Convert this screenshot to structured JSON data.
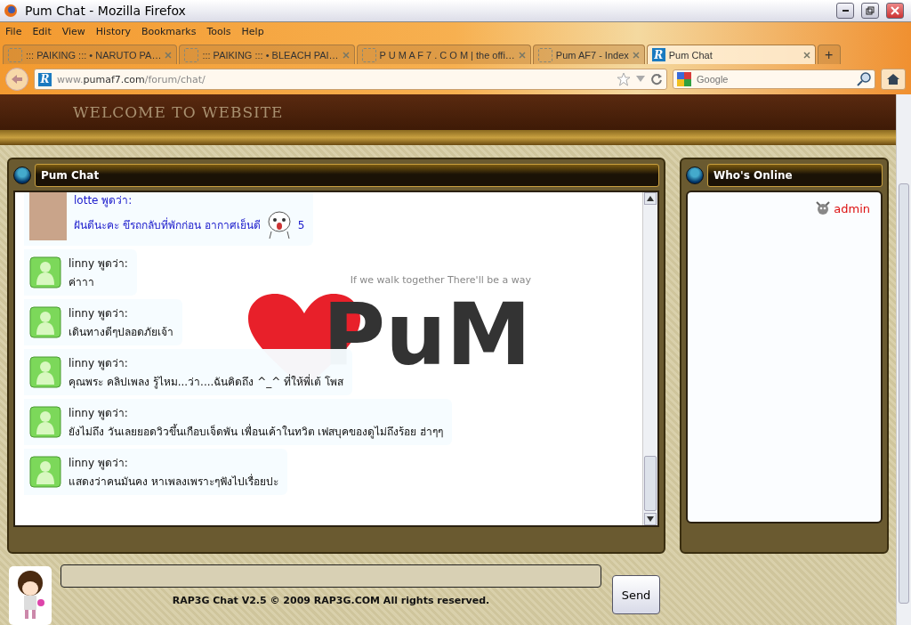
{
  "window": {
    "title": "Pum Chat - Mozilla Firefox"
  },
  "menu": [
    "File",
    "Edit",
    "View",
    "History",
    "Bookmarks",
    "Tools",
    "Help"
  ],
  "tabs": [
    {
      "label": "::: PAIKING ::: • NARUTO PA…",
      "selected": false
    },
    {
      "label": "::: PAIKING ::: • BLEACH PAI…",
      "selected": false
    },
    {
      "label": "P U M A F 7 . C O M | the offi…",
      "selected": false
    },
    {
      "label": "Pum AF7 - Index",
      "selected": false
    },
    {
      "label": "Pum Chat",
      "selected": true
    }
  ],
  "new_tab": "+",
  "tab_logo": "R",
  "address_logo": "R",
  "address": {
    "prefix": "www.",
    "domain": "pumaf7.com",
    "path": "/forum/chat/"
  },
  "search": {
    "placeholder": "Google"
  },
  "header": {
    "title": "WELCOME TO WEBSITE"
  },
  "chat": {
    "title": "Pum Chat",
    "banner": {
      "tagline": "If we walk together There'll be a way",
      "word": "PuM"
    },
    "messages": [
      {
        "kind": "photo",
        "author": "lotte พูดว่า:",
        "text": "ฝันดีนะคะ ขึรถกลับที่พักก่อน อากาศเย็นดี",
        "extra": "5",
        "color": "#1a1acc"
      },
      {
        "kind": "default",
        "author": "linny พูดว่า:",
        "text": "ค่าาา",
        "color": "#111111"
      },
      {
        "kind": "default",
        "author": "linny พูดว่า:",
        "text": "เดินทางดีๆปลอดภัยเจ้า",
        "color": "#111111"
      },
      {
        "kind": "default",
        "author": "linny พูดว่า:",
        "text": "คุณพระ คลิปเพลง รู้ไหม...ว่า....ฉันคิดถึง ^_^ ที่ให้พี่เต้ โพส",
        "color": "#111111"
      },
      {
        "kind": "default",
        "author": "linny พูดว่า:",
        "text": "ยังไม่ถึง วันเลยยอดวิวขึ้นเกือบเจ็ดพัน เพื่อนเค้าในทวิต เฟสบุคของดูไม่ถึงร้อย ฮ่าๆๆ",
        "color": "#111111"
      },
      {
        "kind": "default",
        "author": "linny พูดว่า:",
        "text": "แสดงว่าคนมันคง หาเพลงเพราะๆฟังไปเรื่อยปะ",
        "color": "#111111"
      }
    ]
  },
  "online": {
    "title": "Who's Online",
    "users": [
      {
        "name": "admin",
        "color": "#dd1111"
      }
    ]
  },
  "footer": {
    "copyright": "RAP3G Chat V2.5 © 2009 RAP3G.COM All rights reserved.",
    "send": "Send"
  }
}
